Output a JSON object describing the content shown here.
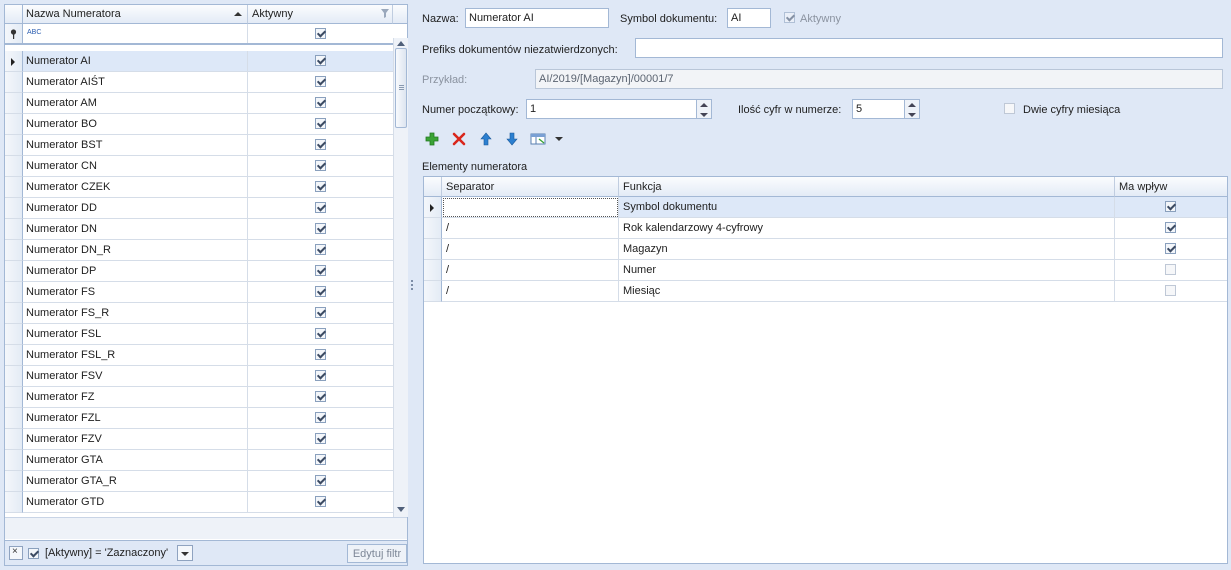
{
  "left_grid": {
    "col_name": "Nazwa Numeratora",
    "col_active": "Aktywny",
    "filter_placeholder": "ABC",
    "rows": [
      {
        "name": "Numerator AI",
        "active": true
      },
      {
        "name": "Numerator AIŚT",
        "active": true
      },
      {
        "name": "Numerator AM",
        "active": true
      },
      {
        "name": "Numerator BO",
        "active": true
      },
      {
        "name": "Numerator BST",
        "active": true
      },
      {
        "name": "Numerator CN",
        "active": true
      },
      {
        "name": "Numerator CZEK",
        "active": true
      },
      {
        "name": "Numerator DD",
        "active": true
      },
      {
        "name": "Numerator DN",
        "active": true
      },
      {
        "name": "Numerator DN_R",
        "active": true
      },
      {
        "name": "Numerator DP",
        "active": true
      },
      {
        "name": "Numerator FS",
        "active": true
      },
      {
        "name": "Numerator FS_R",
        "active": true
      },
      {
        "name": "Numerator FSL",
        "active": true
      },
      {
        "name": "Numerator FSL_R",
        "active": true
      },
      {
        "name": "Numerator FSV",
        "active": true
      },
      {
        "name": "Numerator FZ",
        "active": true
      },
      {
        "name": "Numerator FZL",
        "active": true
      },
      {
        "name": "Numerator FZV",
        "active": true
      },
      {
        "name": "Numerator GTA",
        "active": true
      },
      {
        "name": "Numerator GTA_R",
        "active": true
      },
      {
        "name": "Numerator GTD",
        "active": true
      }
    ],
    "filter_bar": {
      "expression": "[Aktywny] = 'Zaznaczony'",
      "edit_button": "Edytuj filtr"
    }
  },
  "form": {
    "name_label": "Nazwa:",
    "name_value": "Numerator AI",
    "symbol_label": "Symbol dokumentu:",
    "symbol_value": "AI",
    "active_label": "Aktywny",
    "prefix_label": "Prefiks dokumentów niezatwierdzonych:",
    "prefix_value": "",
    "example_label": "Przykład:",
    "example_value": "AI/2019/[Magazyn]/00001/7",
    "start_label": "Numer początkowy:",
    "start_value": "1",
    "digits_label": "Ilość cyfr w numerze:",
    "digits_value": "5",
    "two_digit_month_label": "Dwie cyfry miesiąca",
    "two_digit_month_checked": false
  },
  "toolbar_icons": [
    "add-icon",
    "delete-icon",
    "move-up-icon",
    "move-down-icon",
    "column-chooser-icon"
  ],
  "elements": {
    "title": "Elementy numeratora",
    "col_separator": "Separator",
    "col_function": "Funkcja",
    "col_influence": "Ma wpływ",
    "rows": [
      {
        "separator": "",
        "function": "Symbol dokumentu",
        "influence": true
      },
      {
        "separator": "/",
        "function": "Rok kalendarzowy 4-cyfrowy",
        "influence": true
      },
      {
        "separator": "/",
        "function": "Magazyn",
        "influence": true
      },
      {
        "separator": "/",
        "function": "Numer",
        "influence": false
      },
      {
        "separator": "/",
        "function": "Miesiąc",
        "influence": false
      }
    ]
  },
  "colors": {
    "background": "#dfe8f6",
    "border": "#a3b8d5",
    "selected_row": "#dde8f8",
    "add_green": "#3aa335",
    "delete_red": "#d9261c",
    "arrow_blue": "#2c7fd0"
  }
}
